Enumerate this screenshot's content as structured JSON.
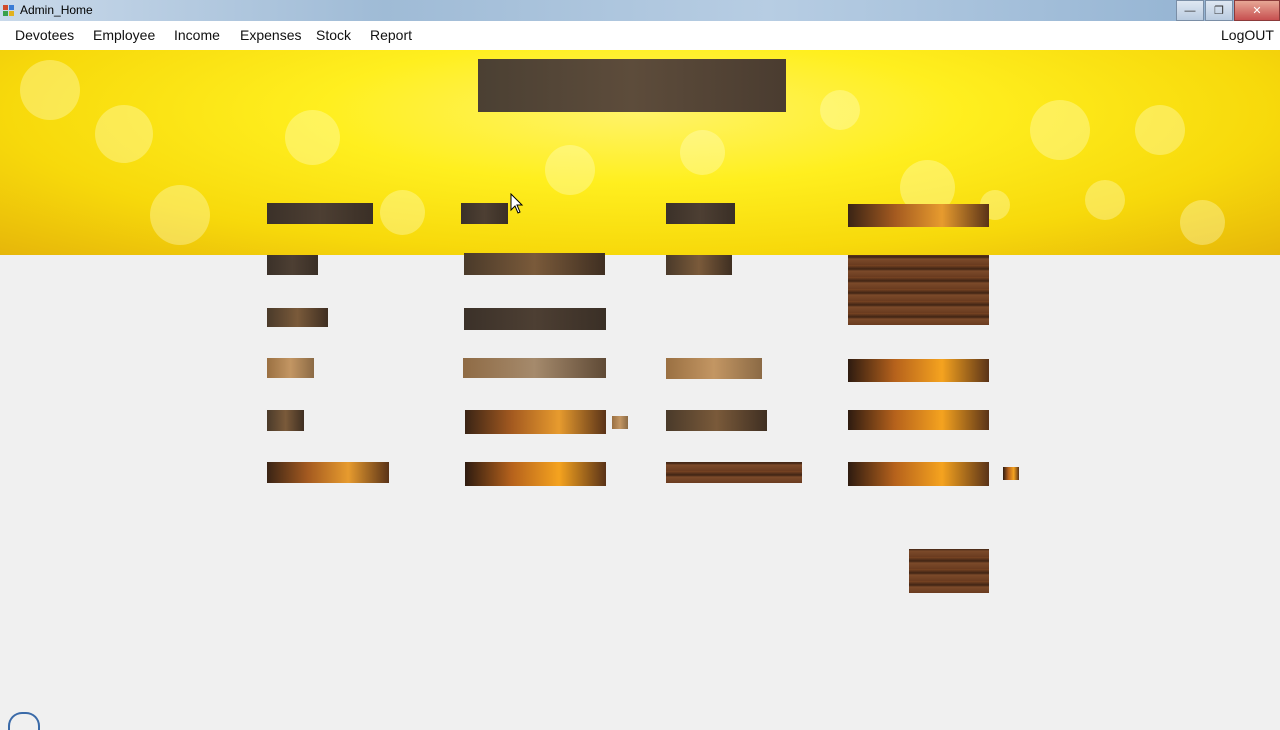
{
  "window": {
    "title": "Admin_Home",
    "controls": [
      "minimize",
      "restore",
      "close"
    ]
  },
  "menu": {
    "items": [
      "Devotees",
      "Employee",
      "Income",
      "Expenses",
      "Stock",
      "Report"
    ],
    "logout": "LogOUT"
  },
  "icons": {
    "app": "app-icon",
    "minimize": "minimize-icon",
    "restore": "restore-icon",
    "close": "close-icon",
    "cursor": "mouse-cursor-icon"
  },
  "colors": {
    "banner_yellow": "#ffef1f",
    "menu_bg": "#ffffff",
    "content_bg": "#f0f0f0"
  }
}
